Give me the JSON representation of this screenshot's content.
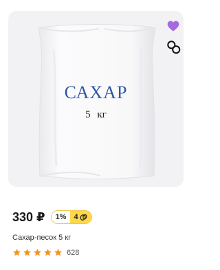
{
  "product": {
    "image_alt_icon": "sugar-bag",
    "bag_title": "САХАР",
    "bag_subtitle": "5 кг",
    "price": "330 ₽",
    "cashback_percent": "1%",
    "cashback_points": "4",
    "name": "Сахар-песок 5 кг",
    "rating": 5,
    "reviews_count": "628"
  },
  "actions": {
    "favorite_icon": "heart-icon",
    "compare_icon": "compare-icon"
  },
  "colors": {
    "favorite": "#a66ae0",
    "star": "#f7941d",
    "cashback": "#ffd84a",
    "bag_text": "#2f57a6"
  }
}
